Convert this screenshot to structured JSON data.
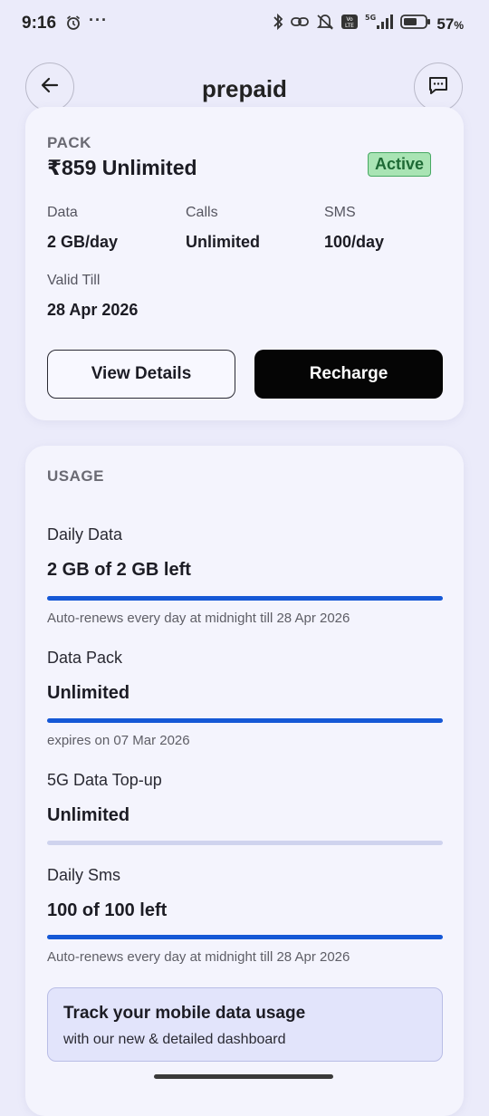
{
  "status_bar": {
    "time": "9:16",
    "dots": "···",
    "battery_percent": "57",
    "percent_sign": "%",
    "network": "5G"
  },
  "header": {
    "title": "prepaid"
  },
  "pack": {
    "section_label": "PACK",
    "name": "₹859 Unlimited",
    "status": "Active",
    "attributes": [
      {
        "label": "Data",
        "value": "2 GB/day"
      },
      {
        "label": "Calls",
        "value": "Unlimited"
      },
      {
        "label": "SMS",
        "value": "100/day"
      },
      {
        "label": "Valid Till",
        "value": "28 Apr 2026"
      }
    ],
    "view_details_label": "View Details",
    "recharge_label": "Recharge"
  },
  "usage": {
    "title": "USAGE",
    "items": [
      {
        "label": "Daily Data",
        "value": "2 GB of 2 GB left",
        "fill_fraction": 1.0,
        "note": "Auto-renews every day at midnight till 28 Apr 2026"
      },
      {
        "label": "Data Pack",
        "value": "Unlimited",
        "fill_fraction": 1.0,
        "note": "expires on 07 Mar 2026"
      },
      {
        "label": "5G Data Top-up",
        "value": "Unlimited",
        "fill_fraction": 0.0,
        "note": ""
      },
      {
        "label": "Daily Sms",
        "value": "100 of 100 left",
        "fill_fraction": 1.0,
        "note": "Auto-renews every day at midnight till 28 Apr 2026"
      }
    ],
    "promo": {
      "title": "Track your mobile data usage",
      "subtitle": "with our new & detailed dashboard"
    }
  },
  "colors": {
    "background": "#ebebfa",
    "card": "#f4f4fd",
    "accent_blue": "#1558d6",
    "active_badge_bg": "#a9e4b4",
    "active_badge_border": "#47a963",
    "recharge_button": "#050505"
  }
}
